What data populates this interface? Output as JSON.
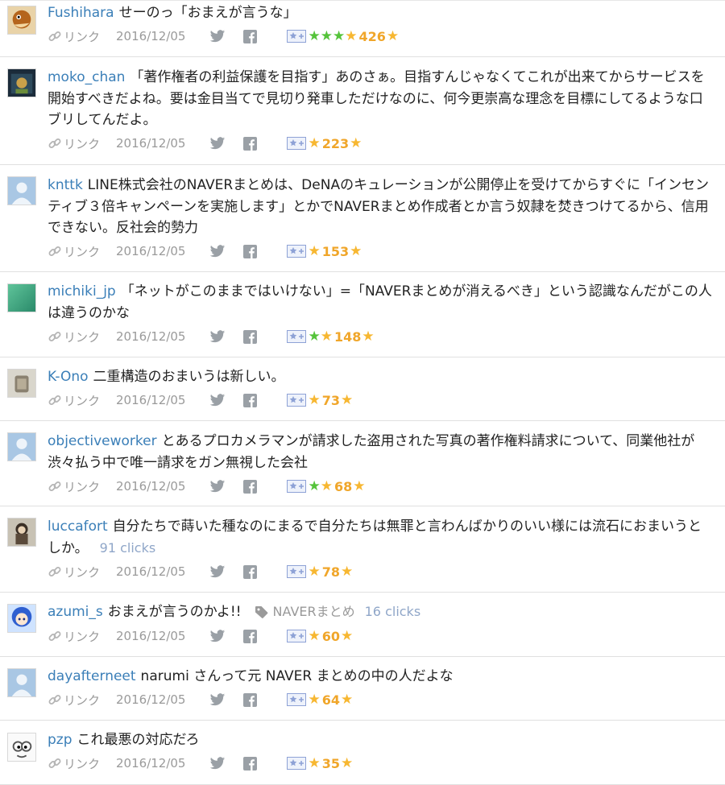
{
  "ui": {
    "link_label": "リンク",
    "colors": {
      "username": "#3b7fb8",
      "meta_gray": "#9a9a9a",
      "star_yellow": "#f7b731",
      "star_green": "#55c33a",
      "clicks": "#8fa6c8"
    }
  },
  "comments": [
    {
      "user": "Fushihara",
      "text": "せーのっ「おまえが言うな」",
      "date": "2016/12/05",
      "green_stars": 3,
      "star_count": "426"
    },
    {
      "user": "moko_chan",
      "text": "「著作権者の利益保護を目指す」あのさぁ。目指すんじゃなくてこれが出来てからサービスを開始すべきだよね。要は金目当てで見切り発車しただけなのに、何今更崇高な理念を目標にしてるような口ブリしてんだよ。",
      "date": "2016/12/05",
      "green_stars": 0,
      "star_count": "223"
    },
    {
      "user": "knttk",
      "text": "LINE株式会社のNAVERまとめは、DeNAのキュレーションが公開停止を受けてからすぐに「インセンティブ３倍キャンペーンを実施します」とかでNAVERまとめ作成者とか言う奴隷を焚きつけてるから、信用できない。反社会的勢力",
      "date": "2016/12/05",
      "green_stars": 0,
      "star_count": "153"
    },
    {
      "user": "michiki_jp",
      "text": "「ネットがこのままではいけない」=「NAVERまとめが消えるべき」という認識なんだがこの人は違うのかな",
      "date": "2016/12/05",
      "green_stars": 1,
      "star_count": "148"
    },
    {
      "user": "K-Ono",
      "text": "二重構造のおまいうは新しい。",
      "date": "2016/12/05",
      "green_stars": 0,
      "star_count": "73"
    },
    {
      "user": "objectiveworker",
      "text": "とあるプロカメラマンが請求した盗用された写真の著作権料請求について、同業他社が渋々払う中で唯一請求をガン無視した会社",
      "date": "2016/12/05",
      "green_stars": 1,
      "star_count": "68"
    },
    {
      "user": "luccafort",
      "text": "自分たちで蒔いた種なのにまるで自分たちは無罪と言わんばかりのいい様には流石におまいうとしか。",
      "clicks": "91 clicks",
      "date": "2016/12/05",
      "green_stars": 0,
      "star_count": "78"
    },
    {
      "user": "azumi_s",
      "text": "おまえが言うのかよ!!",
      "tag": "NAVERまとめ",
      "tag_clicks": "16 clicks",
      "date": "2016/12/05",
      "green_stars": 0,
      "star_count": "60"
    },
    {
      "user": "dayafterneet",
      "text": "narumi さんって元 NAVER まとめの中の人だよな",
      "date": "2016/12/05",
      "green_stars": 0,
      "star_count": "64"
    },
    {
      "user": "pzp",
      "text": "これ最悪の対応だろ",
      "date": "2016/12/05",
      "green_stars": 0,
      "star_count": "35"
    }
  ]
}
